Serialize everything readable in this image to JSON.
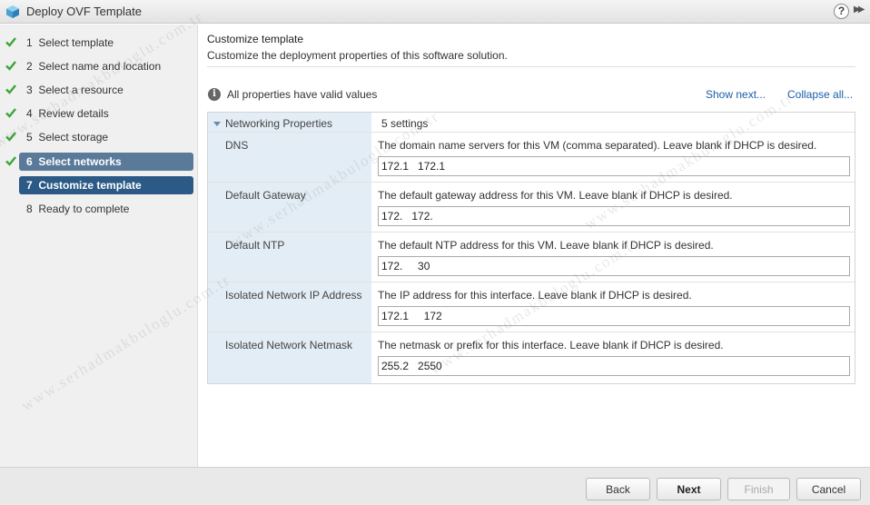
{
  "window": {
    "title": "Deploy OVF Template",
    "help_label": "?",
    "expand_label": "▶▶"
  },
  "steps": [
    {
      "number": "1",
      "label": "Select template",
      "state": "done"
    },
    {
      "number": "2",
      "label": "Select name and location",
      "state": "done"
    },
    {
      "number": "3",
      "label": "Select a resource",
      "state": "done"
    },
    {
      "number": "4",
      "label": "Review details",
      "state": "done"
    },
    {
      "number": "5",
      "label": "Select storage",
      "state": "done"
    },
    {
      "number": "6",
      "label": "Select networks",
      "state": "done-selected"
    },
    {
      "number": "7",
      "label": "Customize template",
      "state": "active"
    },
    {
      "number": "8",
      "label": "Ready to complete",
      "state": "pending"
    }
  ],
  "header": {
    "title": "Customize template",
    "subtitle": "Customize the deployment properties of this software solution."
  },
  "status": {
    "info_icon": "i",
    "text": "All properties have valid values",
    "show_next": "Show next...",
    "collapse_all": "Collapse all..."
  },
  "properties": {
    "group_name": "Networking Properties",
    "group_count": "5 settings",
    "rows": [
      {
        "name": "DNS",
        "description": "The domain name servers for this VM (comma separated). Leave blank if DHCP is desired.",
        "value": "172.1   172.1"
      },
      {
        "name": "Default Gateway",
        "description": "The default gateway address for this VM. Leave blank if DHCP is desired.",
        "value": "172.   172."
      },
      {
        "name": "Default NTP",
        "description": "The default NTP address for this VM. Leave blank if DHCP is desired.",
        "value": "172.     30"
      },
      {
        "name": "Isolated Network IP Address",
        "description": "The IP address for this interface. Leave blank if DHCP is desired.",
        "value": "172.1     172"
      },
      {
        "name": "Isolated Network Netmask",
        "description": "The netmask or prefix for this interface. Leave blank if DHCP is desired.",
        "value": "255.2   2550"
      }
    ]
  },
  "footer": {
    "back": "Back",
    "next": "Next",
    "finish": "Finish",
    "cancel": "Cancel"
  },
  "watermark": "www.serhadmakbuloglu.com.tr",
  "colors": {
    "active_step": "#2b5a86",
    "current_step": "#5a7a9a",
    "check": "#3aa53a",
    "link": "#1a5ea8"
  }
}
